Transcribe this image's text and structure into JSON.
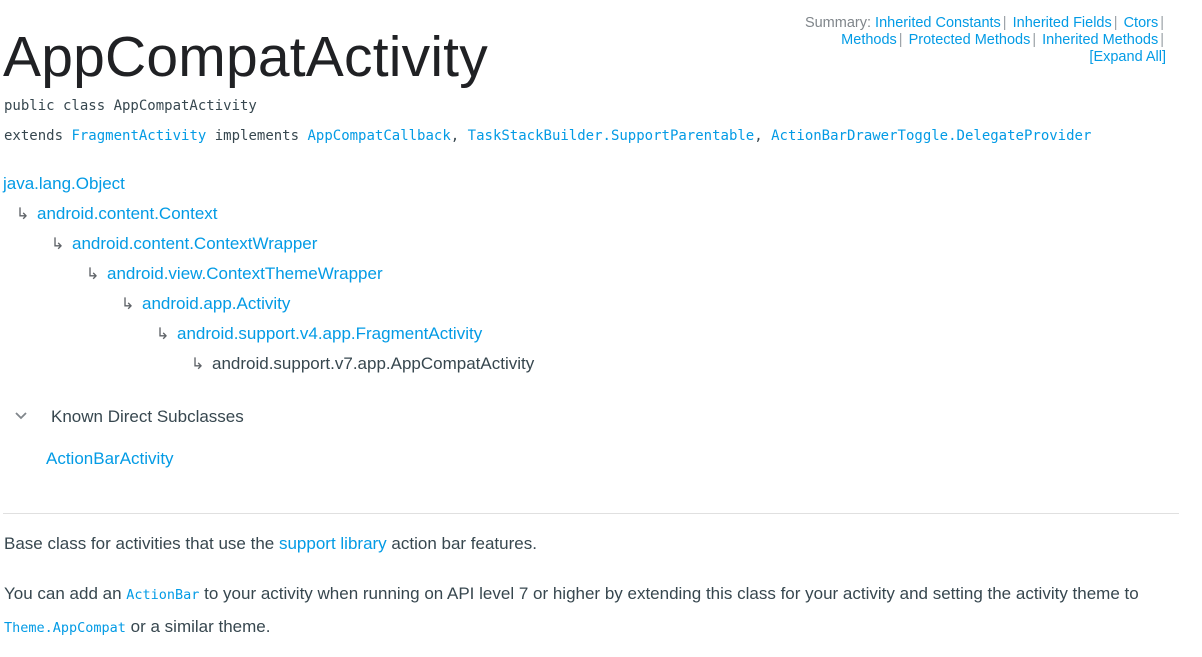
{
  "summary": {
    "label": "Summary:",
    "links": [
      "Inherited Constants",
      "Inherited Fields",
      "Ctors",
      "Methods",
      "Protected Methods",
      "Inherited Methods",
      "[Expand All]"
    ]
  },
  "class_title": "AppCompatActivity",
  "signature": {
    "declaration": "public class AppCompatActivity",
    "extends_kw": "extends",
    "superclass": "FragmentActivity",
    "implements_kw": "implements",
    "interfaces": [
      "AppCompatCallback",
      "TaskStackBuilder.SupportParentable",
      "ActionBarDrawerToggle.DelegateProvider"
    ]
  },
  "inheritance": {
    "arrow": "↳",
    "items": [
      "java.lang.Object",
      "android.content.Context",
      "android.content.ContextWrapper",
      "android.view.ContextThemeWrapper",
      "android.app.Activity",
      "android.support.v4.app.FragmentActivity",
      "android.support.v7.app.AppCompatActivity"
    ]
  },
  "subclasses": {
    "title": "Known Direct Subclasses",
    "items": [
      "ActionBarActivity"
    ]
  },
  "description": {
    "p1_before": "Base class for activities that use the ",
    "p1_link": "support library",
    "p1_after": " action bar features.",
    "p2_before": "You can add an ",
    "p2_code1": "ActionBar",
    "p2_mid": " to your activity when running on API level 7 or higher by extending this class for your activity and setting the activity theme to ",
    "p2_code2": "Theme.AppCompat",
    "p2_after": " or a similar theme."
  },
  "colors": {
    "link": "#039be5",
    "text": "#37474f",
    "muted": "#80868b"
  }
}
